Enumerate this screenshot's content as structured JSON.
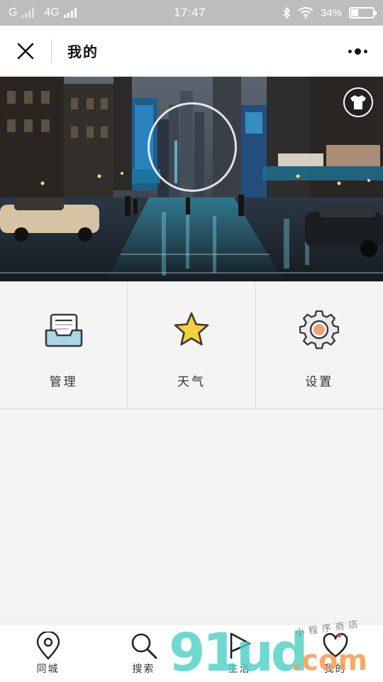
{
  "status_bar": {
    "carrier_g": "G",
    "network": "4G",
    "time": "17:47",
    "battery": "34%",
    "battery_level": 0.34
  },
  "title_bar": {
    "title": "我的",
    "close_icon": "close-icon",
    "more_icon": "more-options-icon"
  },
  "hero": {
    "image": "city-street-night-photo",
    "skin_icon": "tshirt-icon"
  },
  "grid": [
    {
      "label": "管理",
      "icon": "inbox-tray-icon"
    },
    {
      "label": "天气",
      "icon": "star-icon"
    },
    {
      "label": "设置",
      "icon": "gear-icon"
    }
  ],
  "bottom_nav": [
    {
      "label": "同城",
      "icon": "location-pin-icon"
    },
    {
      "label": "搜索",
      "icon": "search-icon"
    },
    {
      "label": "生活",
      "icon": "play-flag-icon"
    },
    {
      "label": "我的",
      "icon": "heart-icon",
      "badge": true
    }
  ],
  "watermark": {
    "digits": "91ud",
    "domain": ".com",
    "tagline": "小程序商店"
  },
  "colors": {
    "status_bar": "#bdbdbd",
    "background": "#f4f4f4",
    "icon_outline": "#3a3a3a",
    "star_fill": "#f5cf3d",
    "tray_fill": "#a9d7e6",
    "gear_center": "#f2a27b",
    "badge": "#e8343a"
  }
}
